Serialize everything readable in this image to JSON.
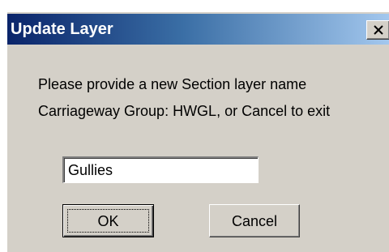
{
  "dialog": {
    "title": "Update Layer",
    "close_icon": "close-icon",
    "message_line1": "Please provide a new Section layer name",
    "message_line2": "Carriageway Group: HWGL, or Cancel to exit",
    "input_value": "Gullies",
    "ok_label": "OK",
    "cancel_label": "Cancel"
  },
  "colors": {
    "titlebar_start": "#0a246a",
    "titlebar_end": "#a6caf0",
    "dialog_face": "#d4d0c8"
  }
}
